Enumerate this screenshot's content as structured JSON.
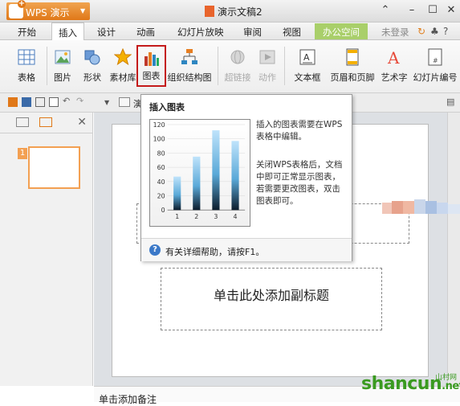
{
  "titlebar": {
    "app_name": "WPS 演示",
    "doc_title": "演示文稿2"
  },
  "menu": {
    "tabs": [
      "开始",
      "插入",
      "设计",
      "动画",
      "幻灯片放映",
      "审阅",
      "视图",
      "办公空间"
    ],
    "active": "插入",
    "login": "未登录"
  },
  "ribbon": {
    "buttons": {
      "table": "表格",
      "picture": "图片",
      "shape": "形状",
      "material": "素材库",
      "chart": "图表",
      "org": "组织结构图",
      "hyperlink": "超链接",
      "action": "动作",
      "textbox": "文本框",
      "header_footer": "页眉和页脚",
      "wordart": "艺术字",
      "slide_number": "幻灯片编号"
    }
  },
  "quickaccess": {
    "partial_text": "演"
  },
  "slide": {
    "thumb_number": "1",
    "subtitle_placeholder": "单击此处添加副标题"
  },
  "notes": {
    "placeholder": "单击添加备注"
  },
  "tooltip": {
    "title": "插入图表",
    "text1": "插入的图表需要在WPS表格中编辑。",
    "text2": "关闭WPS表格后，文档中即可正常显示图表，若需要更改图表，双击图表即可。",
    "help": "有关详细帮助，请按F1。"
  },
  "chart_data": {
    "type": "bar",
    "categories": [
      "1",
      "2",
      "3",
      "4"
    ],
    "values": [
      47,
      75,
      112,
      97
    ],
    "ylim": [
      0,
      120
    ],
    "yticks": [
      0,
      20,
      40,
      60,
      80,
      100,
      120
    ],
    "title": "",
    "xlabel": "",
    "ylabel": ""
  },
  "watermark": {
    "text": "shancun",
    "suffix": ".net",
    "small": "山村网"
  }
}
